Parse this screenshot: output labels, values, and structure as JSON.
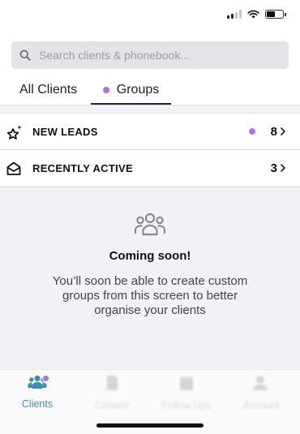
{
  "search": {
    "placeholder": "Search clients & phonebook..."
  },
  "tabs": [
    {
      "label": "All Clients",
      "active": false
    },
    {
      "label": "Groups",
      "active": true,
      "indicator_color": "#b46ee6"
    }
  ],
  "groups": [
    {
      "icon": "sparkle-star-icon",
      "label": "NEW LEADS",
      "count": "8",
      "has_unread_dot": true
    },
    {
      "icon": "open-envelope-icon",
      "label": "RECENTLY ACTIVE",
      "count": "3",
      "has_unread_dot": false
    }
  ],
  "empty_state": {
    "icon": "people-group-icon",
    "title": "Coming soon!",
    "description": "You’ll soon be able to create custom groups from this screen to better organise your clients"
  },
  "tab_bar": [
    {
      "label": "Clients",
      "icon": "people-icon",
      "active": true,
      "has_badge": true
    },
    {
      "label": "Content",
      "icon": "document-icon",
      "active": false
    },
    {
      "label": "Follow Ups",
      "icon": "calendar-icon",
      "active": false
    },
    {
      "label": "Account",
      "icon": "person-icon",
      "active": false
    }
  ],
  "colors": {
    "accent": "#3b8fb6",
    "purple": "#b46ee6",
    "underline": "#202833"
  }
}
